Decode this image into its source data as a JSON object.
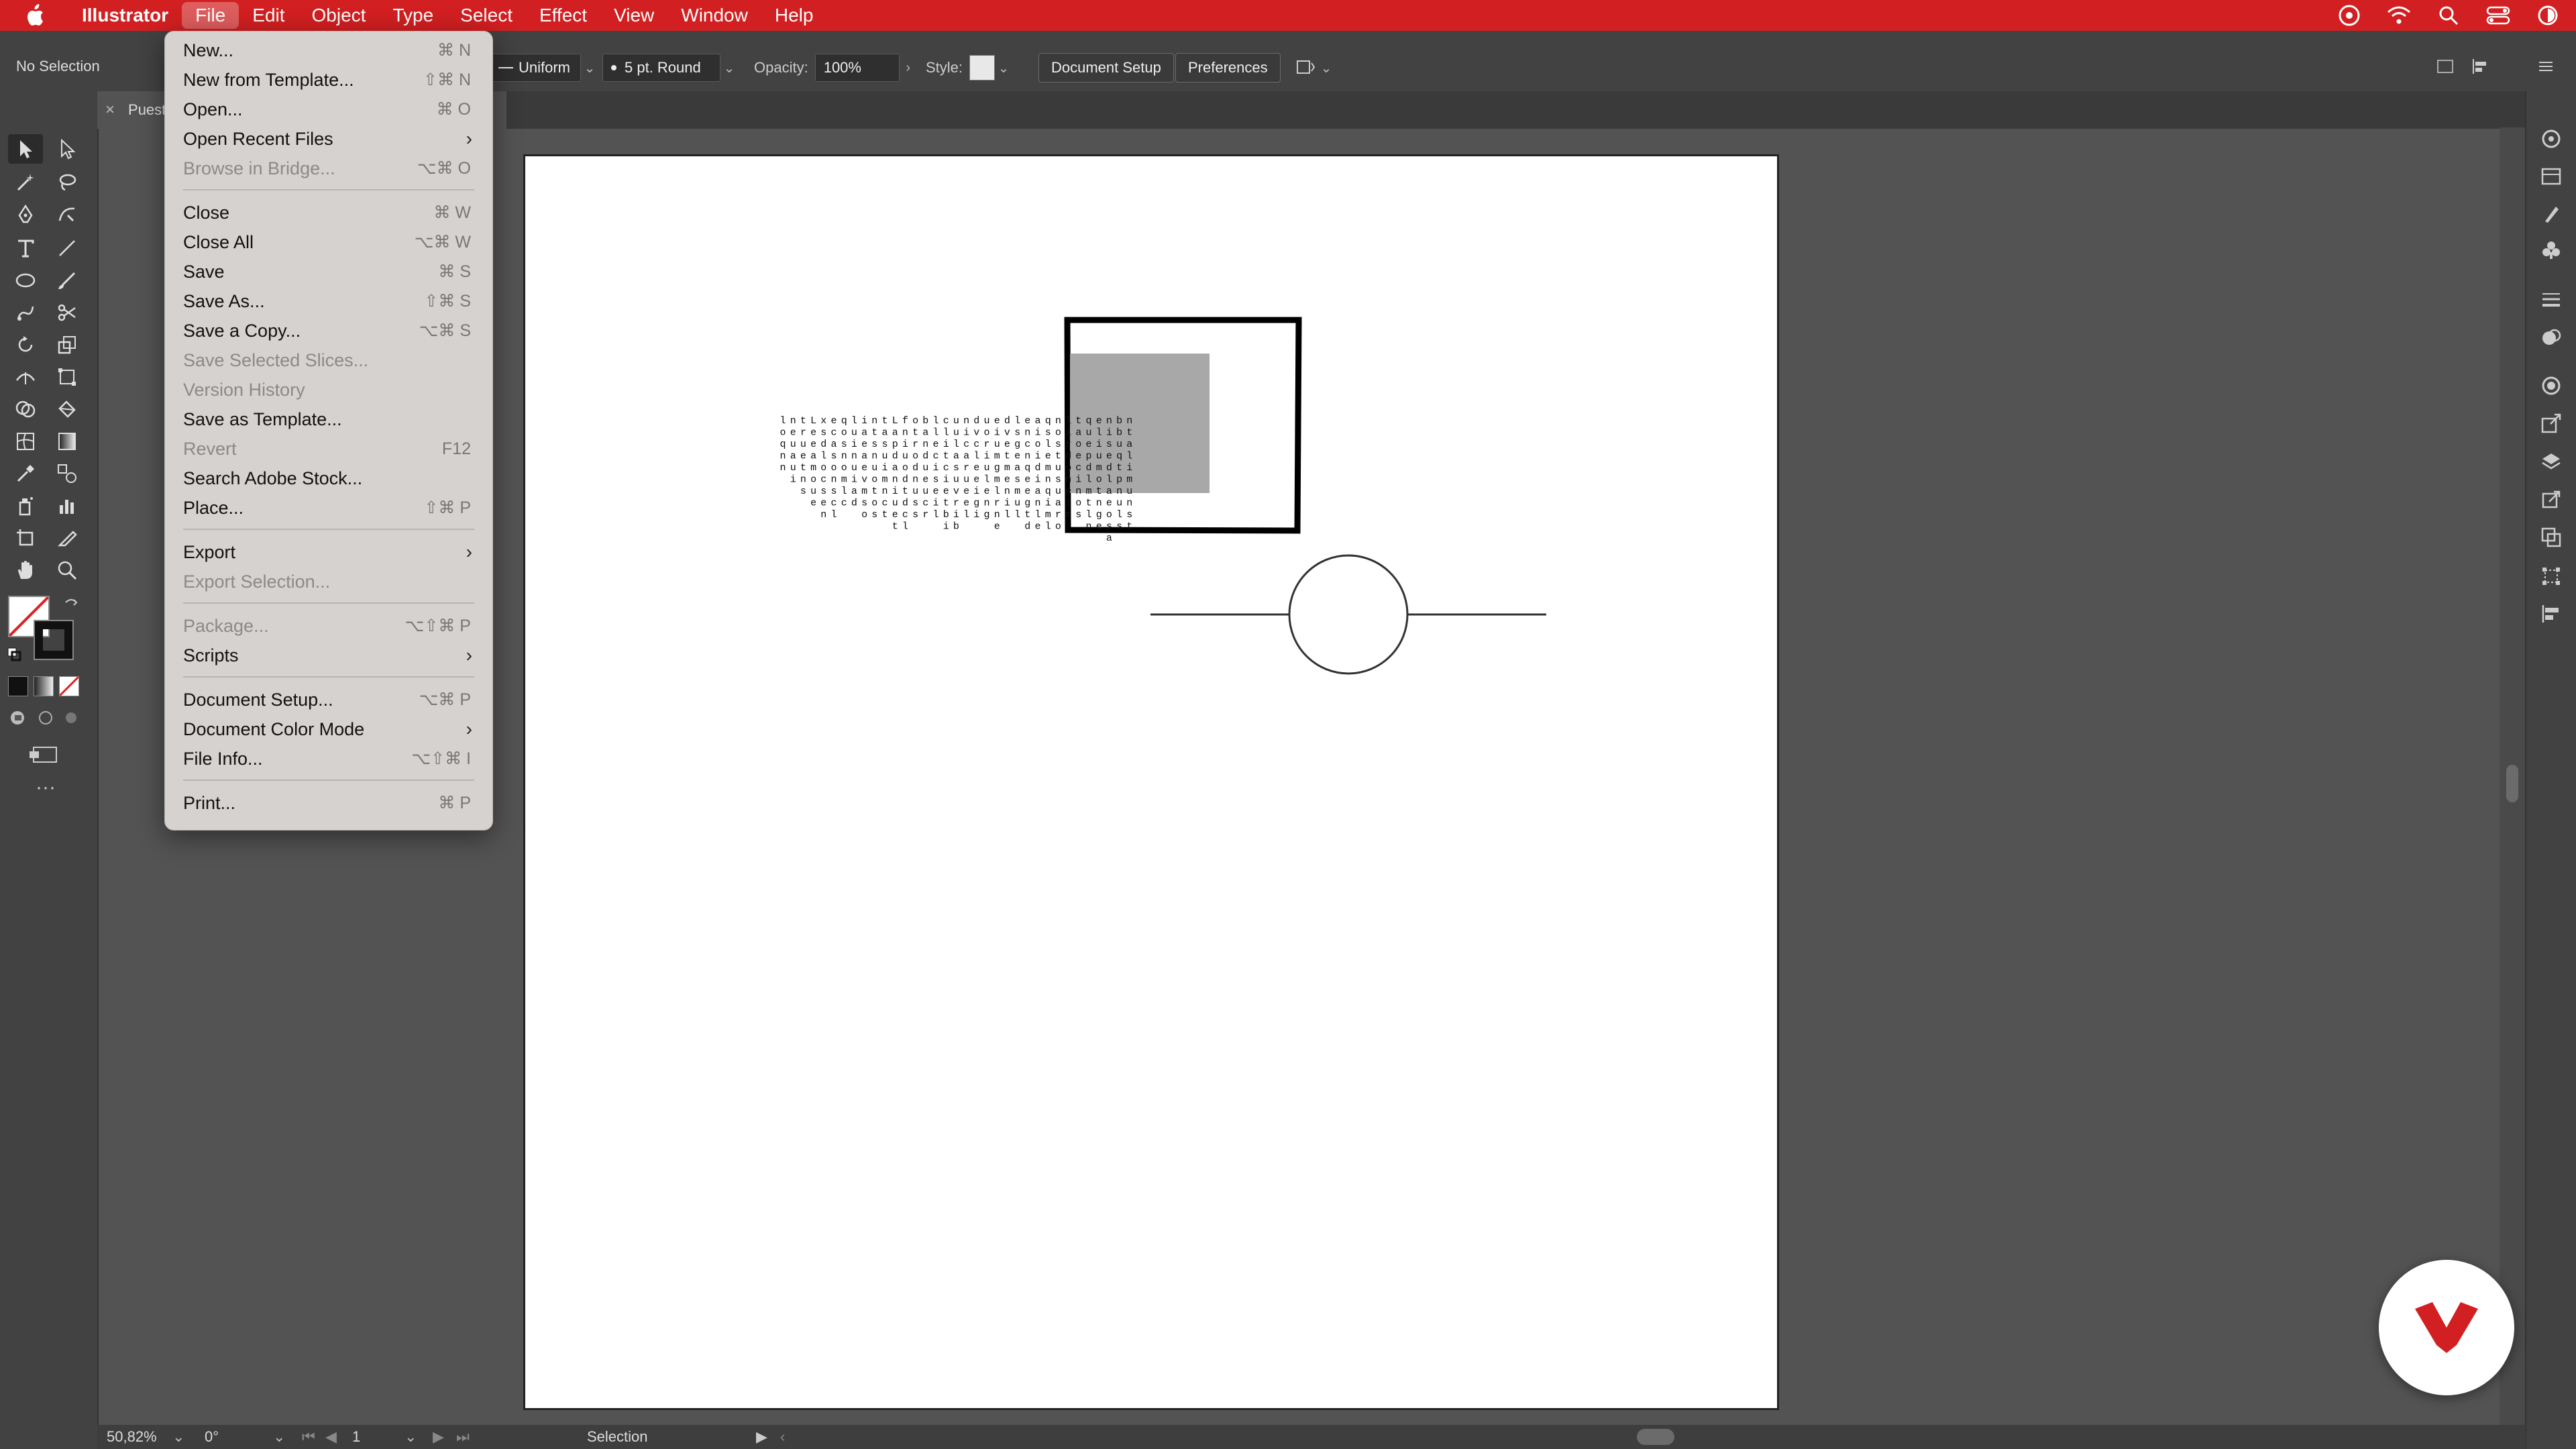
{
  "menubar": {
    "app": "Illustrator",
    "items": [
      "File",
      "Edit",
      "Object",
      "Type",
      "Select",
      "Effect",
      "View",
      "Window",
      "Help"
    ],
    "active": "File",
    "color": "#d21f21"
  },
  "controlbar": {
    "selection_state": "No Selection",
    "stroke_profile": "Uniform",
    "brush": "5 pt. Round",
    "opacity_label": "Opacity:",
    "opacity_value": "100%",
    "style_label": "Style:",
    "document_setup": "Document Setup",
    "preferences": "Preferences"
  },
  "tab": {
    "title": "Puest"
  },
  "file_menu": {
    "items": [
      {
        "label": "New...",
        "shortcut": "⌘ N",
        "disabled": false
      },
      {
        "label": "New from Template...",
        "shortcut": "⇧⌘ N",
        "disabled": false
      },
      {
        "label": "Open...",
        "shortcut": "⌘ O",
        "disabled": false
      },
      {
        "label": "Open Recent Files",
        "submenu": true,
        "disabled": false
      },
      {
        "label": "Browse in Bridge...",
        "shortcut": "⌥⌘ O",
        "disabled": true
      },
      {
        "label": "Close",
        "shortcut": "⌘ W",
        "disabled": false
      },
      {
        "label": "Close All",
        "shortcut": "⌥⌘ W",
        "disabled": false
      },
      {
        "label": "Save",
        "shortcut": "⌘ S",
        "disabled": false
      },
      {
        "label": "Save As...",
        "shortcut": "⇧⌘ S",
        "disabled": false
      },
      {
        "label": "Save a Copy...",
        "shortcut": "⌥⌘ S",
        "disabled": false
      },
      {
        "label": "Save Selected Slices...",
        "disabled": true
      },
      {
        "label": "Version History",
        "disabled": true
      },
      {
        "label": "Save as Template...",
        "disabled": false
      },
      {
        "label": "Revert",
        "shortcut": "F12",
        "disabled": true
      },
      {
        "label": "Search Adobe Stock...",
        "disabled": false
      },
      {
        "label": "Place...",
        "shortcut": "⇧⌘ P",
        "disabled": false
      },
      {
        "label": "Export",
        "submenu": true,
        "disabled": false
      },
      {
        "label": "Export Selection...",
        "disabled": true
      },
      {
        "label": "Package...",
        "shortcut": "⌥⇧⌘ P",
        "disabled": true
      },
      {
        "label": "Scripts",
        "submenu": true,
        "disabled": false
      },
      {
        "label": "Document Setup...",
        "shortcut": "⌥⌘ P",
        "disabled": false
      },
      {
        "label": "Document Color Mode",
        "submenu": true,
        "disabled": false
      },
      {
        "label": "File Info...",
        "shortcut": "⌥⇧⌘ I",
        "disabled": false
      },
      {
        "label": "Print...",
        "shortcut": "⌘ P",
        "disabled": false
      }
    ]
  },
  "statusbar": {
    "zoom": "50,82%",
    "rotation": "0°",
    "artboard": "1",
    "tool": "Selection"
  },
  "canvas": {
    "text_columns": [
      "loqnn",
      "neuaui",
      "truetns",
      "Leeamoue",
      "xsdlocsen",
      "ecasonscl",
      "qosnomlc",
      "luinuiad",
      "iaeaevmso",
      "ntsnuotos",
      "tasuimnct",
      "Lapdaniuet",
      "fniuodtdcl",
      "otrodnuss",
      "bandueucr",
      "lleciseil",
      "clitcietbi",
      "uulasuvrib",
      "nicarueel",
      "dvcleeigi",
      "uoriuleng",
      "eiumgmlrne",
      "dvetmenil",
      "lsgeasmul",
      "encnqeegtd",
      "aioidianle",
      "qslemnqiml",
      "nostusuaro",
      "lirdoneim",
      "taoecinos",
      "quepdlmtln",
      "eliumotnge",
      "nisedlaeosa",
      "bbuqtpnuls",
      "ntalimunst"
    ]
  },
  "icons": {
    "apple": "apple-icon",
    "brand_badge": "brand-logo-icon"
  }
}
